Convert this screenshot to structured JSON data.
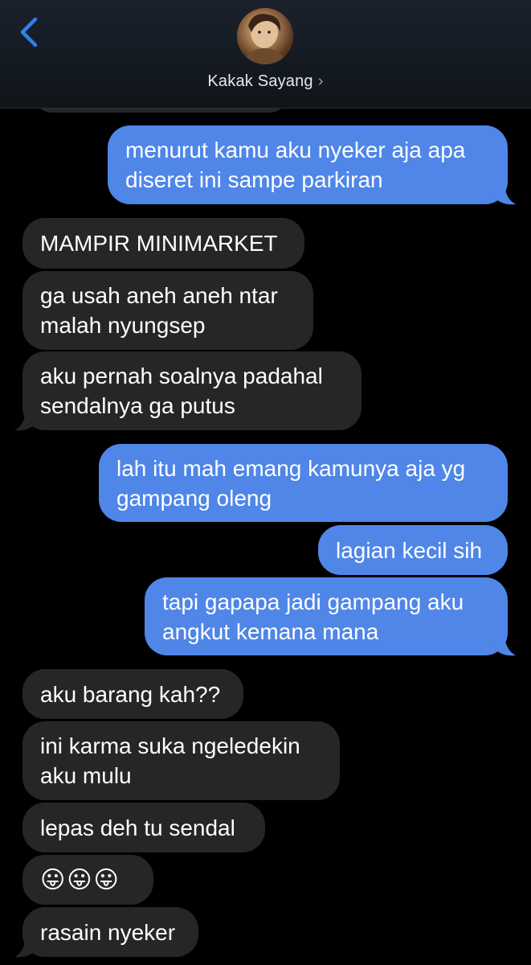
{
  "header": {
    "contact_name": "Kakak Sayang",
    "chevron": "›",
    "back_icon": "chevron-left-icon",
    "accent": "#2f80ed"
  },
  "colors": {
    "incoming": "#262629",
    "outgoing": "#4f86e8",
    "background": "#000000"
  },
  "messages": [
    {
      "from": "me",
      "text_lines": [
        "menurut kamu aku nyeker aja apa",
        "diseret ini sampe parkiran"
      ]
    },
    {
      "from": "them",
      "text_lines": [
        "MAMPIR MINIMARKET"
      ]
    },
    {
      "from": "them",
      "text_lines": [
        "ga usah aneh aneh ntar",
        "malah nyungsep"
      ]
    },
    {
      "from": "them",
      "text_lines": [
        "aku pernah soalnya padahal",
        "sendalnya ga putus"
      ]
    },
    {
      "from": "me",
      "text_lines": [
        "lah itu mah emang kamunya aja yg",
        "gampang oleng"
      ]
    },
    {
      "from": "me",
      "text_lines": [
        "lagian kecil sih"
      ]
    },
    {
      "from": "me",
      "text_lines": [
        "tapi gapapa jadi gampang aku",
        "angkut kemana mana"
      ]
    },
    {
      "from": "them",
      "text_lines": [
        "aku barang kah??"
      ]
    },
    {
      "from": "them",
      "text_lines": [
        "ini karma suka ngeledekin",
        "aku mulu"
      ]
    },
    {
      "from": "them",
      "text_lines": [
        "lepas deh tu sendal"
      ]
    },
    {
      "from": "them",
      "text_lines": [
        "😛😛😛"
      ]
    },
    {
      "from": "them",
      "text_lines": [
        "rasain nyeker"
      ]
    }
  ]
}
